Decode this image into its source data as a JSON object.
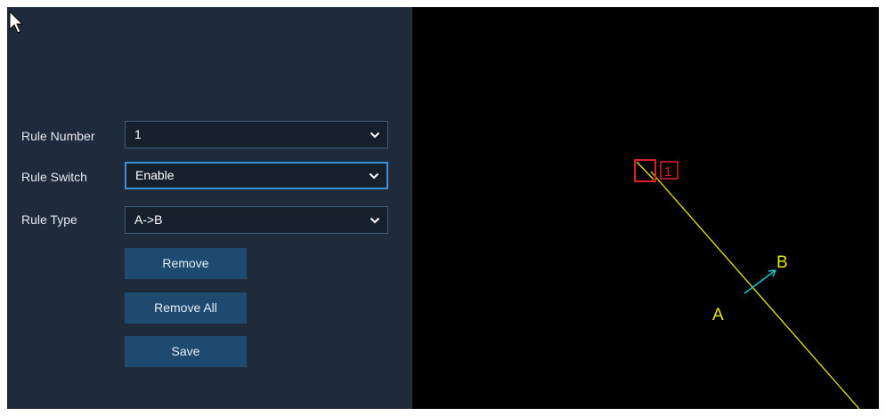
{
  "form": {
    "rule_number": {
      "label": "Rule Number",
      "value": "1"
    },
    "rule_switch": {
      "label": "Rule Switch",
      "value": "Enable"
    },
    "rule_type": {
      "label": "Rule Type",
      "value": "A->B"
    }
  },
  "buttons": {
    "remove": "Remove",
    "remove_all": "Remove All",
    "save": "Save"
  },
  "overlay": {
    "point_a": "A",
    "point_b": "B",
    "rule_id": "1",
    "line_color": "#e8e800",
    "marker_color": "#e02020",
    "arrow_color": "#19c6d6"
  }
}
